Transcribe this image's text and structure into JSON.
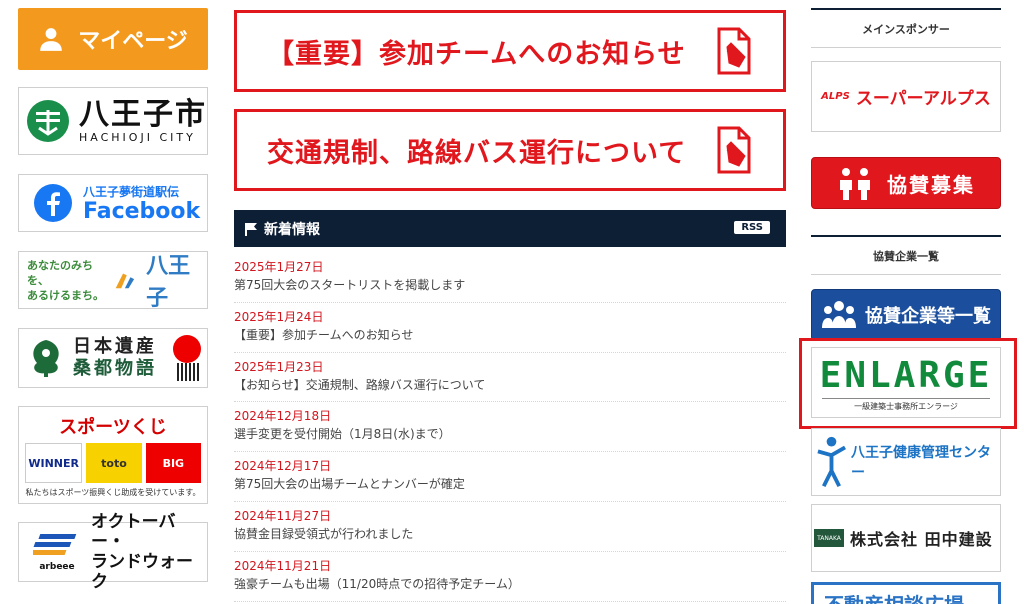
{
  "left": {
    "mypage_label": "マイページ",
    "hachioji": {
      "name": "八王子市",
      "sub": "HACHIOJI CITY"
    },
    "facebook": {
      "line1": "八王子夢街道駅伝",
      "line2": "Facebook"
    },
    "michi": {
      "line1": "あなたのみちを、",
      "line2": "あるけるまち。",
      "city": "八王子"
    },
    "isan": {
      "line1": "日本遺産",
      "line2": "桑都物語"
    },
    "toto": {
      "title": "スポーツくじ",
      "logo1": "WINNER",
      "logo2": "toto",
      "logo3": "BIG",
      "note": "私たちはスポーツ振興くじ助成を受けています。"
    },
    "october": {
      "brand": "arbeee",
      "line1": "オクトーバー・",
      "line2": "ランドウォーク"
    }
  },
  "notices": [
    {
      "label": "【重要】参加チームへのお知らせ"
    },
    {
      "label": "交通規制、路線バス運行について"
    }
  ],
  "news": {
    "title": "新着情報",
    "rss": "RSS",
    "items": [
      {
        "date": "2025年1月27日",
        "title": "第75回大会のスタートリストを掲載します"
      },
      {
        "date": "2025年1月24日",
        "title": "【重要】参加チームへのお知らせ"
      },
      {
        "date": "2025年1月23日",
        "title": "【お知らせ】交通規制、路線バス運行について"
      },
      {
        "date": "2024年12月18日",
        "title": "選手変更を受付開始（1月8日(水)まで）"
      },
      {
        "date": "2024年12月17日",
        "title": "第75回大会の出場チームとナンバーが確定"
      },
      {
        "date": "2024年11月27日",
        "title": "協賛金目録受領式が行われました"
      },
      {
        "date": "2024年11月21日",
        "title": "強豪チームも出場（11/20時点での招待予定チーム）"
      }
    ]
  },
  "right": {
    "main_sponsor_heading": "メインスポンサー",
    "alps": {
      "mark": "ALPS",
      "name": "スーパーアルプス"
    },
    "kyosan_label": "協賛募集",
    "sponsors_heading": "協賛企業一覧",
    "ichiran_label": "協賛企業等一覧",
    "enlarge": {
      "name": "ENLARGE",
      "sub": "一級建築士事務所エンラージ"
    },
    "kenko": {
      "name": "八王子健康管理センター"
    },
    "tanaka": {
      "mark": "TANAKA",
      "name": "株式会社 田中建設"
    },
    "fudosan": {
      "name": "不動産相談広場"
    }
  },
  "colors": {
    "accent_red": "#e1171e",
    "navy": "#0c1f35",
    "orange": "#f39a1e",
    "blue": "#1b4e9c",
    "green": "#128a3c"
  }
}
